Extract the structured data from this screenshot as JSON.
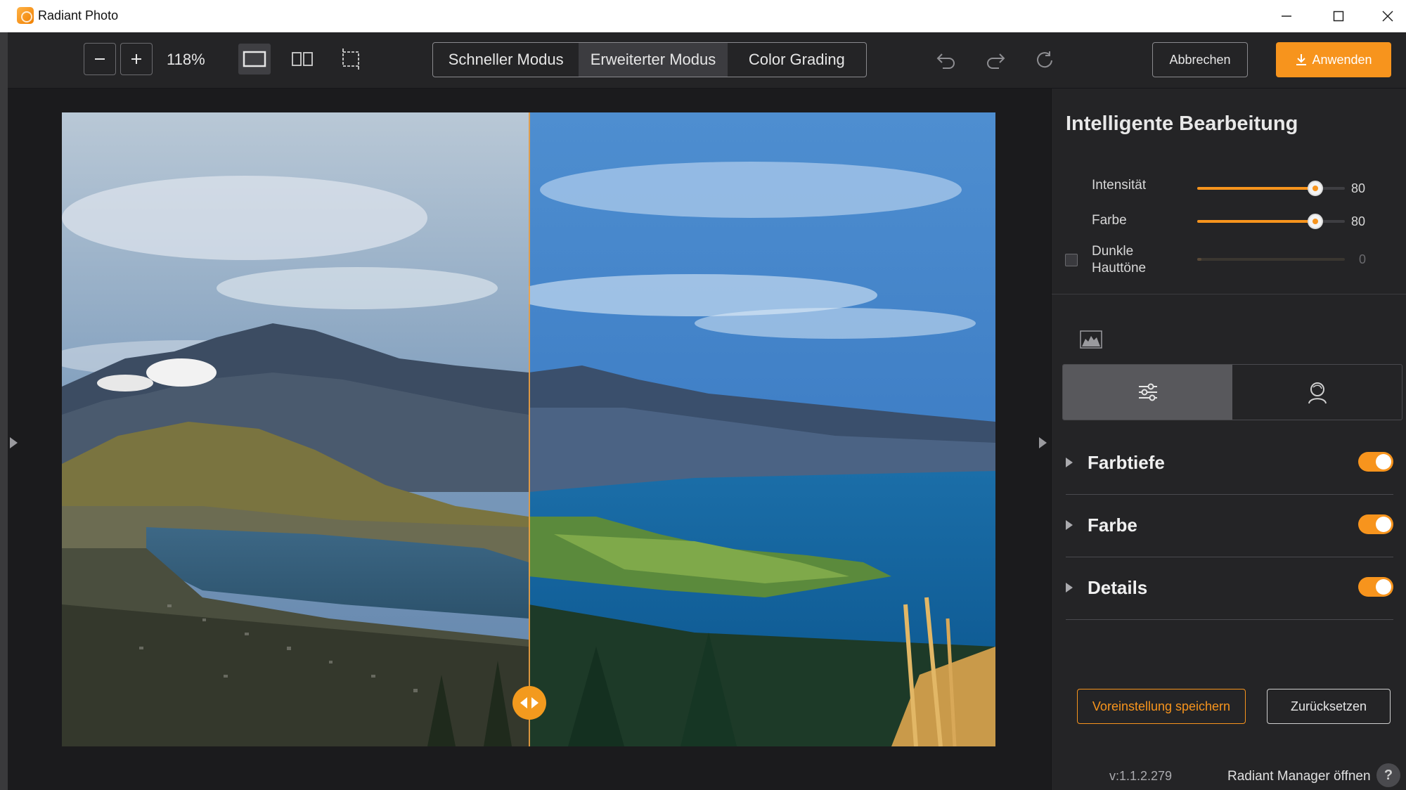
{
  "window": {
    "title": "Radiant Photo",
    "app_icon": "radiant-photo-icon",
    "controls": [
      "minimize-icon",
      "maximize-icon",
      "close-icon"
    ]
  },
  "toolbar": {
    "zoom_out_icon": "minus-icon",
    "zoom_in_icon": "plus-icon",
    "zoom_level": "118%",
    "view_modes": [
      {
        "icon": "single-view-icon",
        "active": true
      },
      {
        "icon": "split-view-icon",
        "active": false
      },
      {
        "icon": "crop-icon",
        "active": false
      }
    ],
    "modes": [
      {
        "label": "Schneller Modus",
        "active": false
      },
      {
        "label": "Erweiterter Modus",
        "active": true
      },
      {
        "label": "Color Grading",
        "active": false
      }
    ],
    "history_icons": [
      "undo-icon",
      "redo-icon",
      "reset-icon"
    ],
    "cancel_label": "Abbrechen",
    "apply_label": "Anwenden",
    "apply_icon": "download-icon"
  },
  "canvas": {
    "photo_alt": "Landscape: lake and mountains with town in foreground, before/after split",
    "split_handle_icon": "split-compare-handle-icon",
    "split_position": 0.5
  },
  "panel": {
    "title": "Intelligente Bearbeitung",
    "sliders": [
      {
        "label": "Intensität",
        "value": "80",
        "level": 80,
        "enabled": true
      },
      {
        "label": "Farbe",
        "value": "80",
        "level": 80,
        "enabled": true
      },
      {
        "label": "Dunkle\nHauttöne",
        "value": "0",
        "level": 0,
        "enabled": false
      }
    ],
    "histogram_icon": "histogram-icon",
    "tabs": [
      {
        "icon": "adjustments-icon",
        "active": true
      },
      {
        "icon": "portrait-icon",
        "active": false
      }
    ],
    "sections": [
      {
        "label": "Farbtiefe",
        "enabled": true
      },
      {
        "label": "Farbe",
        "enabled": true
      },
      {
        "label": "Details",
        "enabled": true
      }
    ],
    "save_preset_label": "Voreinstellung speichern",
    "reset_label": "Zurücksetzen",
    "version": "v:1.1.2.279",
    "manager_link": "Radiant Manager öffnen",
    "help_label": "?"
  },
  "colors": {
    "accent": "#f7941d",
    "background": "#1e1e20",
    "panel": "#242426",
    "text": "#e6e6e6"
  }
}
